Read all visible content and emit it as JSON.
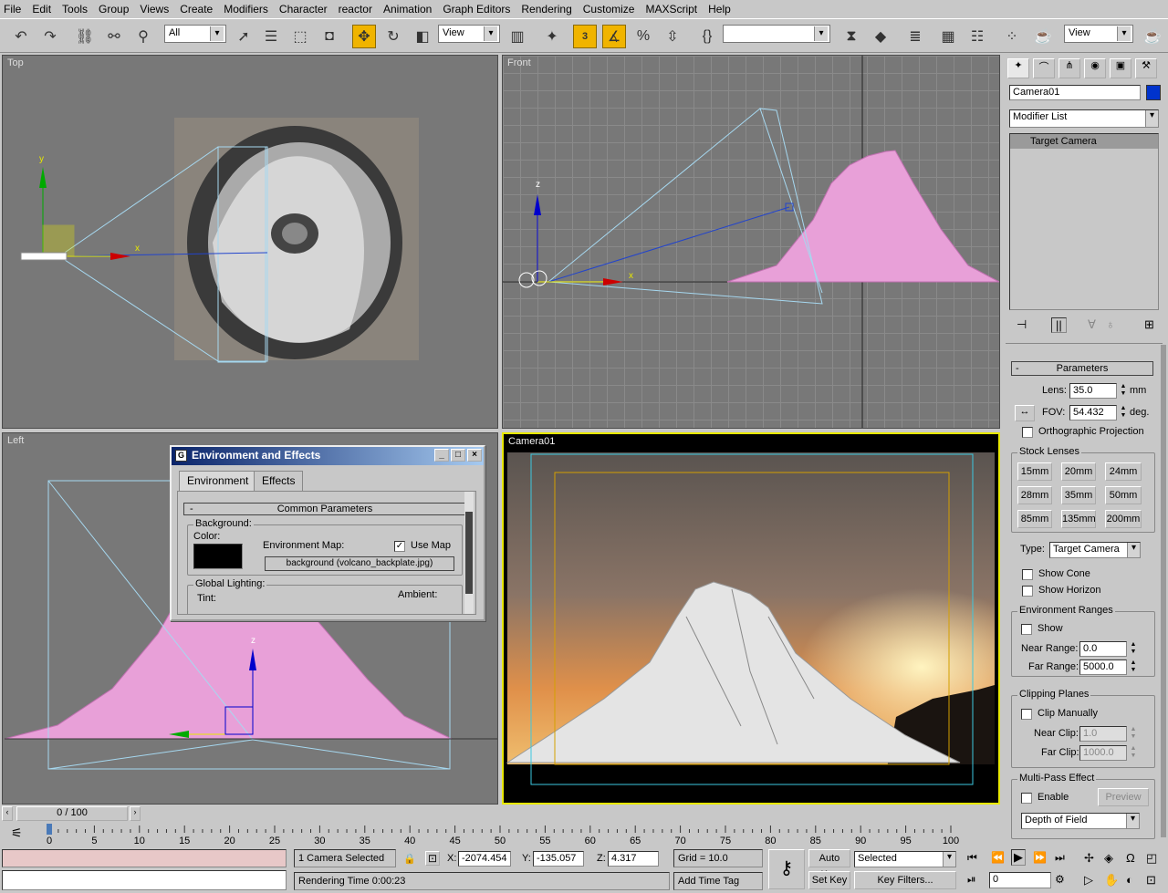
{
  "menu": [
    "File",
    "Edit",
    "Tools",
    "Group",
    "Views",
    "Create",
    "Modifiers",
    "Character",
    "reactor",
    "Animation",
    "Graph Editors",
    "Rendering",
    "Customize",
    "MAXScript",
    "Help"
  ],
  "toolbar": {
    "selection_filter": "All",
    "ref_coord": "View",
    "ref_coord2": "View",
    "snap_label": "3"
  },
  "viewports": {
    "top": "Top",
    "front": "Front",
    "left": "Left",
    "camera": "Camera01"
  },
  "dialog": {
    "title": "Environment and Effects",
    "tabs": [
      "Environment",
      "Effects"
    ],
    "rollout": "Common Parameters",
    "background_label": "Background:",
    "color_label": "Color:",
    "env_map_label": "Environment Map:",
    "use_map_label": "Use Map",
    "map_button": "background (volcano_backplate.jpg)",
    "global_lighting": "Global Lighting:",
    "tint": "Tint:",
    "ambient": "Ambient:"
  },
  "command_panel": {
    "object_name": "Camera01",
    "modifier_list": "Modifier List",
    "stack_item": "Target Camera",
    "params_title": "Parameters",
    "lens_label": "Lens:",
    "lens_value": "35.0",
    "lens_unit": "mm",
    "fov_label": "FOV:",
    "fov_value": "54.432",
    "fov_unit": "deg.",
    "ortho": "Orthographic Projection",
    "stock_lenses": "Stock Lenses",
    "lenses": [
      "15mm",
      "20mm",
      "24mm",
      "28mm",
      "35mm",
      "50mm",
      "85mm",
      "135mm",
      "200mm"
    ],
    "type_label": "Type:",
    "type_value": "Target Camera",
    "show_cone": "Show Cone",
    "show_horizon": "Show Horizon",
    "env_ranges": "Environment Ranges",
    "show": "Show",
    "near_range_label": "Near Range:",
    "near_range": "0.0",
    "far_range_label": "Far Range:",
    "far_range": "5000.0",
    "clipping": "Clipping Planes",
    "clip_manually": "Clip Manually",
    "near_clip_label": "Near Clip:",
    "near_clip": "1.0",
    "far_clip_label": "Far Clip:",
    "far_clip": "1000.0",
    "multipass": "Multi-Pass Effect",
    "enable": "Enable",
    "preview": "Preview",
    "effect": "Depth of Field"
  },
  "timeline": {
    "frame": "0 / 100",
    "ticks": [
      "0",
      "5",
      "10",
      "15",
      "20",
      "25",
      "30",
      "35",
      "40",
      "45",
      "50",
      "55",
      "60",
      "65",
      "70",
      "75",
      "80",
      "85",
      "90",
      "95",
      "100"
    ]
  },
  "status": {
    "selection": "1 Camera Selected",
    "prompt": "Rendering Time  0:00:23",
    "x_label": "X:",
    "x": "-2074.454",
    "y_label": "Y:",
    "y": "-135.057",
    "z_label": "Z:",
    "z": "4.317",
    "grid": "Grid = 10.0",
    "add_time_tag": "Add Time Tag",
    "auto_key": "Auto Key",
    "set_key": "Set Key",
    "key_mode": "Selected",
    "key_filters": "Key Filters...",
    "current_frame": "0"
  },
  "colors": {
    "active_vp": "#e8e800",
    "selection_pink": "#e8a0d8",
    "dialog_title": "#0a246a",
    "color_swatch": "#000000",
    "obj_color": "#0033cc"
  }
}
